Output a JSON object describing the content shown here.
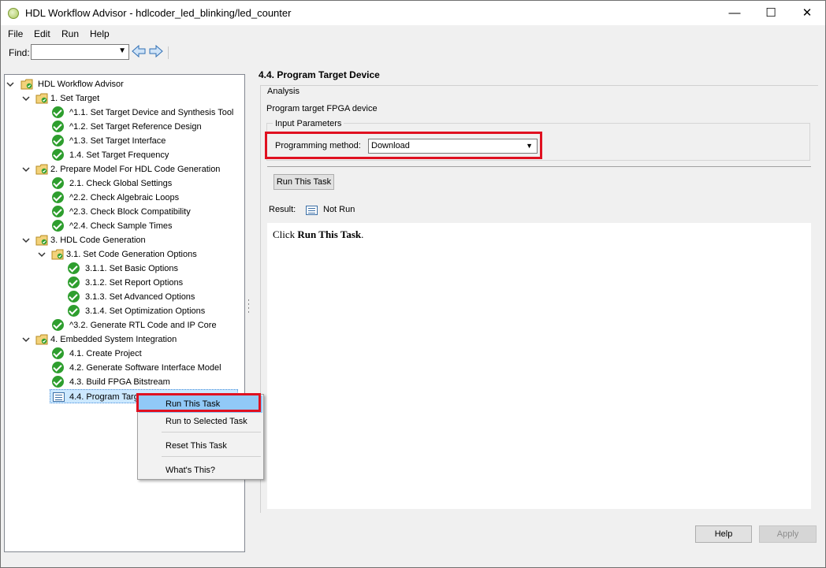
{
  "window": {
    "title": "HDL Workflow Advisor - hdlcoder_led_blinking/led_counter",
    "minimize_glyph": "—",
    "maximize_glyph": "☐",
    "close_glyph": "✕"
  },
  "menu": [
    "File",
    "Edit",
    "Run",
    "Help"
  ],
  "find": {
    "label": "Find:",
    "value": ""
  },
  "tree": {
    "root": "HDL Workflow Advisor",
    "items": [
      {
        "label": "1. Set Target"
      },
      {
        "label": "^1.1. Set Target Device and Synthesis Tool"
      },
      {
        "label": "^1.2. Set Target Reference Design"
      },
      {
        "label": "^1.3. Set Target Interface"
      },
      {
        "label": "1.4. Set Target Frequency"
      },
      {
        "label": "2. Prepare Model For HDL Code Generation"
      },
      {
        "label": "2.1. Check Global Settings"
      },
      {
        "label": "^2.2. Check Algebraic Loops"
      },
      {
        "label": "^2.3. Check Block Compatibility"
      },
      {
        "label": "^2.4. Check Sample Times"
      },
      {
        "label": "3. HDL Code Generation"
      },
      {
        "label": "3.1. Set Code Generation Options"
      },
      {
        "label": "3.1.1. Set Basic Options"
      },
      {
        "label": "3.1.2. Set Report Options"
      },
      {
        "label": "3.1.3. Set Advanced Options"
      },
      {
        "label": "3.1.4. Set Optimization Options"
      },
      {
        "label": "^3.2. Generate RTL Code and IP Core"
      },
      {
        "label": "4. Embedded System Integration"
      },
      {
        "label": "4.1. Create Project"
      },
      {
        "label": "4.2. Generate Software Interface Model"
      },
      {
        "label": "4.3. Build FPGA Bitstream"
      },
      {
        "label": "4.4. Program Target Device"
      }
    ]
  },
  "context_menu": {
    "items": [
      "Run This Task",
      "Run to Selected Task",
      "Reset This Task",
      "What's This?"
    ]
  },
  "right": {
    "title": "4.4. Program Target Device",
    "analysis_label": "Analysis",
    "description": "Program target FPGA device",
    "input_params_label": "Input Parameters",
    "programming_method_label": "Programming method:",
    "programming_method_value": "Download",
    "run_button": "Run This Task",
    "result_label": "Result:",
    "result_value": "Not Run",
    "result_text_prefix": "Click ",
    "result_text_bold": "Run This Task",
    "result_text_suffix": "."
  },
  "footer": {
    "help_button": "Help",
    "apply_button": "Apply"
  },
  "colors": {
    "highlight_red": "#e01020",
    "check_green": "#2e9e2e",
    "selection": "#cce8ff",
    "menu_hover": "#91c9f7"
  }
}
